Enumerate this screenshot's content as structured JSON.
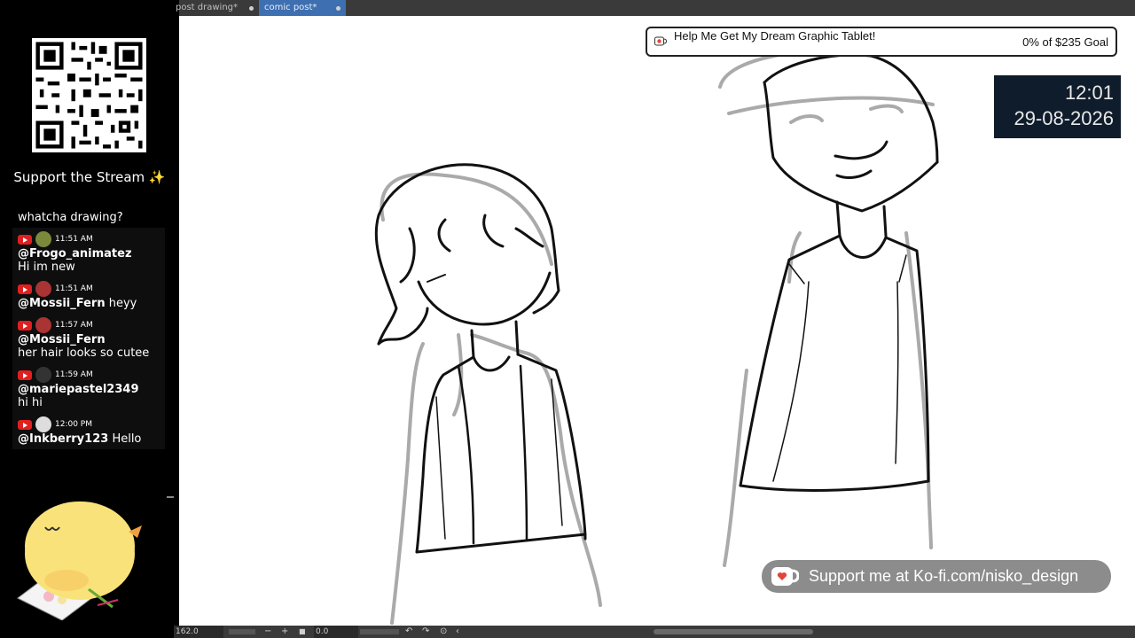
{
  "tabs": [
    {
      "label": "post drawing*",
      "active": false
    },
    {
      "label": "comic post*",
      "active": true
    }
  ],
  "sidebar": {
    "support_title": "Support the Stream ✨",
    "chat": [
      {
        "text": "whatcha drawing?",
        "platform": "",
        "time": "",
        "user": ""
      },
      {
        "platform": "youtube",
        "time": "11:51 AM",
        "user": "@Frogo_animatez",
        "text": "Hi im new",
        "avatar_color": "#7a8a3a"
      },
      {
        "platform": "youtube",
        "time": "11:51 AM",
        "user": "@Mossii_Fern",
        "text": "heyy",
        "avatar_color": "#a33"
      },
      {
        "platform": "youtube",
        "time": "11:57 AM",
        "user": "@Mossii_Fern",
        "text": "her hair looks so cutee",
        "avatar_color": "#a33"
      },
      {
        "platform": "youtube",
        "time": "11:59 AM",
        "user": "@mariepastel2349",
        "text": "hi hi",
        "avatar_color": "#333"
      },
      {
        "platform": "youtube",
        "time": "12:00 PM",
        "user": "@Inkberry123",
        "text": "Hello",
        "avatar_color": "#ddd"
      }
    ]
  },
  "goal": {
    "title": "Help Me Get My Dream Graphic Tablet!",
    "progress": "0% of $235 Goal"
  },
  "clock": {
    "time": "12:01",
    "date": "29-08-2026"
  },
  "kofi": {
    "text": "Support me at Ko-fi.com/nisko_design"
  },
  "statusbar": {
    "zoom": "162.0",
    "minus": "−",
    "plus": "+",
    "angle": "0.0"
  },
  "colors": {
    "kofi_heart": "#e4433a",
    "youtube": "#e02020",
    "active_tab": "#3e6fb0"
  }
}
